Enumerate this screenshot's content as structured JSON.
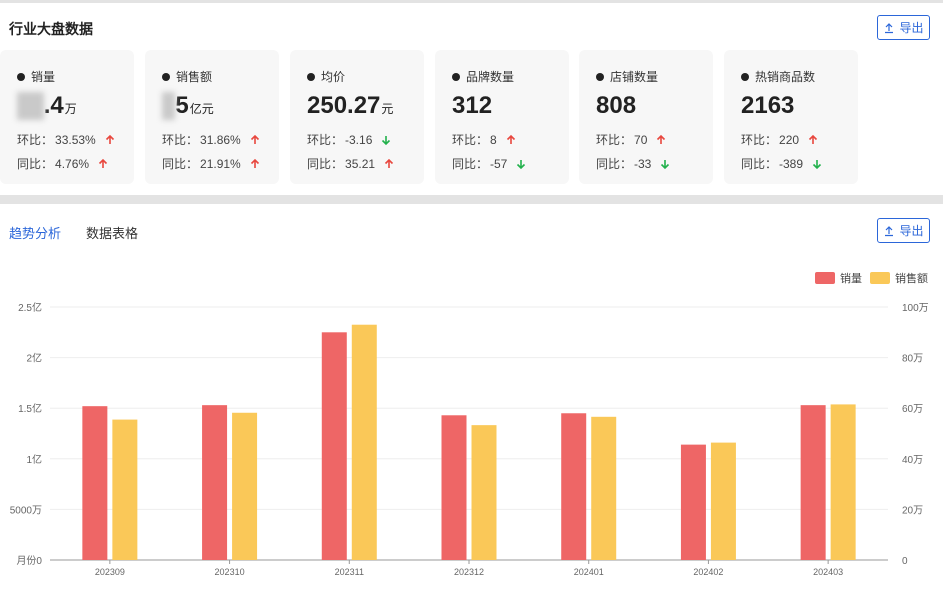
{
  "header": {
    "title": "行业大盘数据",
    "export_label": "导出"
  },
  "cards": [
    {
      "label": "销量",
      "value_blur": "31",
      "value": ".4",
      "unit": "万",
      "row1_label": "环比：",
      "row1_value": "33.53%",
      "row1_dir": "up",
      "row2_label": "同比：",
      "row2_value": "4.76%",
      "row2_dir": "up"
    },
    {
      "label": "销售额",
      "value_blur": "7",
      "value": "5",
      "unit": "亿元",
      "row1_label": "环比：",
      "row1_value": "31.86%",
      "row1_dir": "up",
      "row2_label": "同比：",
      "row2_value": "21.91%",
      "row2_dir": "up"
    },
    {
      "label": "均价",
      "value_blur": "",
      "value": "250.27",
      "unit": "元",
      "row1_label": "环比：",
      "row1_value": "-3.16",
      "row1_dir": "down",
      "row2_label": "同比：",
      "row2_value": "35.21",
      "row2_dir": "up"
    },
    {
      "label": "品牌数量",
      "value_blur": "",
      "value": "312",
      "unit": "",
      "row1_label": "环比：",
      "row1_value": "8",
      "row1_dir": "up",
      "row2_label": "同比：",
      "row2_value": "-57",
      "row2_dir": "down"
    },
    {
      "label": "店铺数量",
      "value_blur": "",
      "value": "808",
      "unit": "",
      "row1_label": "环比：",
      "row1_value": "70",
      "row1_dir": "up",
      "row2_label": "同比：",
      "row2_value": "-33",
      "row2_dir": "down"
    },
    {
      "label": "热销商品数",
      "value_blur": "",
      "value": "2163",
      "unit": "",
      "row1_label": "环比：",
      "row1_value": "220",
      "row1_dir": "up",
      "row2_label": "同比：",
      "row2_value": "-389",
      "row2_dir": "down"
    }
  ],
  "tabs": [
    {
      "label": "趋势分析",
      "active": true
    },
    {
      "label": "数据表格",
      "active": false
    }
  ],
  "colors": {
    "accent": "#2b66d9",
    "up": "#e8473e",
    "down": "#22b14c",
    "series1": "#ee6666",
    "series2": "#fac858"
  },
  "chart_data": {
    "type": "bar",
    "categories": [
      "202309",
      "202310",
      "202311",
      "202312",
      "202401",
      "202402",
      "202403"
    ],
    "series": [
      {
        "name": "销量",
        "axis": "left",
        "values": [
          152000000,
          153000000,
          225000000,
          143000000,
          145000000,
          114000000,
          153000000
        ]
      },
      {
        "name": "销售额",
        "axis": "right",
        "values": [
          555000,
          582000,
          930000,
          533000,
          566000,
          464000,
          615000
        ]
      }
    ],
    "left_axis": {
      "ylim": [
        0,
        250000000
      ],
      "ticks": [
        "月份0",
        "5000万",
        "1亿",
        "1.5亿",
        "2亿",
        "2.5亿"
      ]
    },
    "right_axis": {
      "ylim": [
        0,
        1000000
      ],
      "ticks": [
        "0",
        "20万",
        "40万",
        "60万",
        "80万",
        "100万"
      ]
    },
    "legend_position": "top-right",
    "grid": true
  }
}
